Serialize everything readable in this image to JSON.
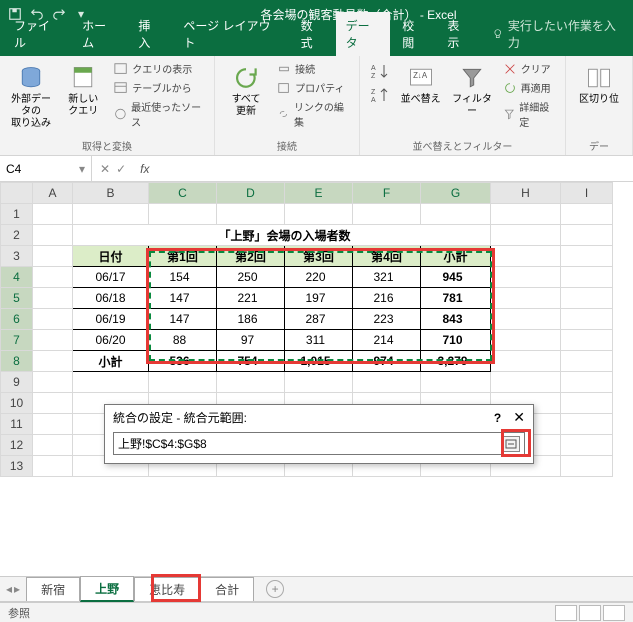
{
  "titlebar": {
    "title": "各会場の観客動員数（合計）  -  Excel"
  },
  "tabs": {
    "file": "ファイル",
    "home": "ホーム",
    "insert": "挿入",
    "layout": "ページ レイアウト",
    "formulas": "数式",
    "data": "データ",
    "review": "校閲",
    "view": "表示",
    "tellme": "実行したい作業を入力"
  },
  "ribbon": {
    "g1": {
      "label": "取得と変換",
      "ext": "外部データの\n取り込み",
      "newq": "新しい\nクエリ",
      "showq": "クエリの表示",
      "fromtbl": "テーブルから",
      "recent": "最近使ったソース"
    },
    "g2": {
      "label": "接続",
      "refresh": "すべて\n更新",
      "conn": "接続",
      "prop": "プロパティ",
      "editl": "リンクの編集"
    },
    "g3": {
      "label": "並べ替えとフィルター",
      "sort": "並べ替え",
      "filter": "フィルター",
      "clear": "クリア",
      "reapply": "再適用",
      "adv": "詳細設定"
    },
    "g4": {
      "label": "デー",
      "split": "区切り位"
    }
  },
  "namebox": {
    "ref": "C4",
    "fx": "fx"
  },
  "columns": [
    "A",
    "B",
    "C",
    "D",
    "E",
    "F",
    "G",
    "H",
    "I"
  ],
  "rows": [
    "1",
    "2",
    "3",
    "4",
    "5",
    "6",
    "7",
    "8",
    "9",
    "10",
    "11",
    "12",
    "13"
  ],
  "sheet": {
    "title": "「上野」会場の入場者数",
    "headers": {
      "date": "日付",
      "r1": "第1回",
      "r2": "第2回",
      "r3": "第3回",
      "r4": "第4回",
      "sub": "小計"
    },
    "data": [
      {
        "date": "06/17",
        "v": [
          "154",
          "250",
          "220",
          "321"
        ],
        "sub": "945"
      },
      {
        "date": "06/18",
        "v": [
          "147",
          "221",
          "197",
          "216"
        ],
        "sub": "781"
      },
      {
        "date": "06/19",
        "v": [
          "147",
          "186",
          "287",
          "223"
        ],
        "sub": "843"
      },
      {
        "date": "06/20",
        "v": [
          "88",
          "97",
          "311",
          "214"
        ],
        "sub": "710"
      }
    ],
    "totals": {
      "label": "小計",
      "v": [
        "536",
        "754",
        "1,015",
        "974"
      ],
      "sub": "3,279"
    }
  },
  "dialog": {
    "title": "統合の設定 - 統合元範囲:",
    "value": "上野!$C$4:$G$8"
  },
  "sheettabs": {
    "t1": "新宿",
    "t2": "上野",
    "t3": "恵比寿",
    "t4": "合計"
  },
  "status": {
    "mode": "参照"
  }
}
